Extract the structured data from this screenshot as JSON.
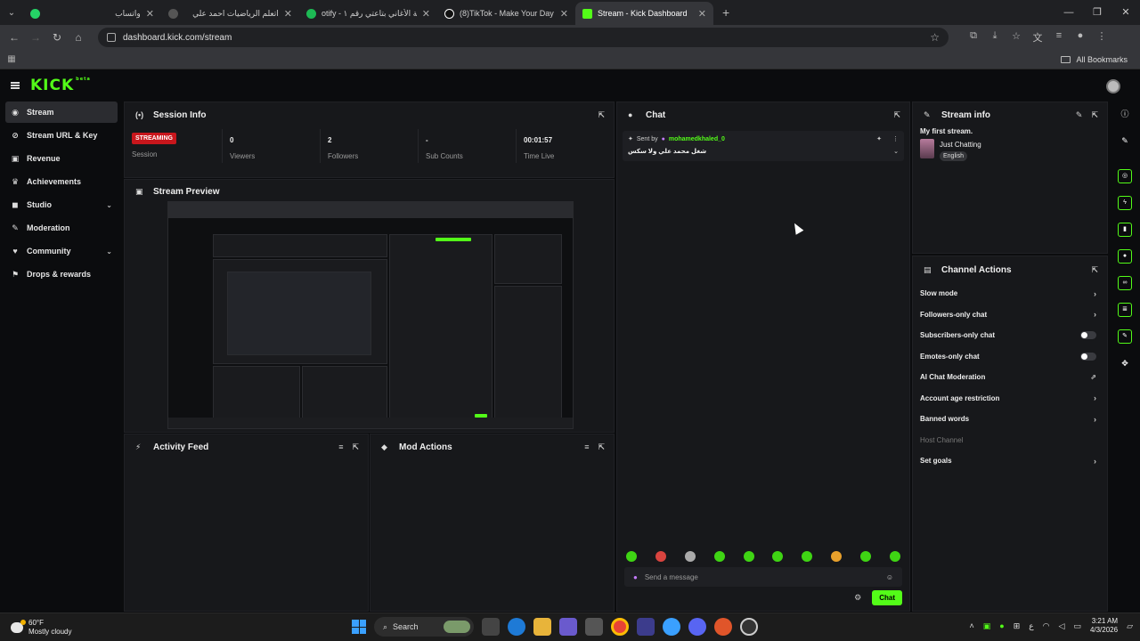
{
  "browser": {
    "tabs": [
      {
        "title": "واتساب",
        "icon_color": "#25d366",
        "active": false
      },
      {
        "title": "اتعلم الرياضيات احمد علي",
        "icon_color": "#777777",
        "active": false
      },
      {
        "title": "otify - قايمة الأغاني بتاعتي رقم ١",
        "icon_color": "#1db954",
        "active": false
      },
      {
        "title": "(8)TikTok - Make Your Day",
        "icon_color": "#ffffff",
        "active": false
      },
      {
        "title": "Stream - Kick Dashboard",
        "icon_color": "#53fc18",
        "active": true
      }
    ],
    "url": "dashboard.kick.com/stream",
    "all_bookmarks": "All Bookmarks"
  },
  "logo": {
    "text": "KICK",
    "sup": "beta"
  },
  "sidebar": {
    "items": [
      {
        "label": "Stream",
        "icon": "signal-icon"
      },
      {
        "label": "Stream URL & Key",
        "icon": "link-icon"
      },
      {
        "label": "Revenue",
        "icon": "revenue-icon"
      },
      {
        "label": "Achievements",
        "icon": "trophy-icon"
      },
      {
        "label": "Studio",
        "icon": "studio-icon"
      },
      {
        "label": "Moderation",
        "icon": "wrench-icon"
      },
      {
        "label": "Community",
        "icon": "community-icon"
      },
      {
        "label": "Drops & rewards",
        "icon": "gift-icon"
      }
    ]
  },
  "session": {
    "title": "Session Info",
    "status_badge": "STREAMING",
    "stats": [
      {
        "value": "",
        "label": "Session"
      },
      {
        "value": "0",
        "label": "Viewers"
      },
      {
        "value": "2",
        "label": "Followers"
      },
      {
        "value": "-",
        "label": "Sub Counts"
      },
      {
        "value": "00:01:57",
        "label": "Time Live"
      }
    ]
  },
  "preview": {
    "title": "Stream Preview"
  },
  "activity": {
    "title": "Activity Feed"
  },
  "mod_actions": {
    "title": "Mod Actions"
  },
  "chat": {
    "title": "Chat",
    "pinned_sent_by": "Sent by",
    "pinned_user": "mohamedkhaled_0",
    "pinned_message": "شغل محمد علي ولا سكس",
    "input_placeholder": "Send a message",
    "send_label": "Chat"
  },
  "stream_info": {
    "title": "Stream info",
    "stream_title": "My first stream.",
    "category": "Just Chatting",
    "language": "English"
  },
  "channel_actions": {
    "title": "Channel Actions",
    "rows": [
      {
        "label": "Slow mode",
        "control": "chevron"
      },
      {
        "label": "Followers-only chat",
        "control": "chevron"
      },
      {
        "label": "Subscribers-only chat",
        "control": "toggle"
      },
      {
        "label": "Emotes-only chat",
        "control": "toggle"
      },
      {
        "label": "AI Chat Moderation",
        "control": "external"
      },
      {
        "label": "Account age restriction",
        "control": "chevron"
      },
      {
        "label": "Banned words",
        "control": "chevron"
      },
      {
        "label": "Host Channel",
        "control": "none"
      },
      {
        "label": "Set goals",
        "control": "chevron"
      }
    ]
  },
  "taskbar": {
    "temp": "60°F",
    "weather": "Mostly cloudy",
    "search": "Search",
    "time": "3:21 AM",
    "date": "4/3/2026",
    "lang": "ع"
  },
  "colors": {
    "accent": "#53fc18",
    "live": "#c8161c"
  }
}
